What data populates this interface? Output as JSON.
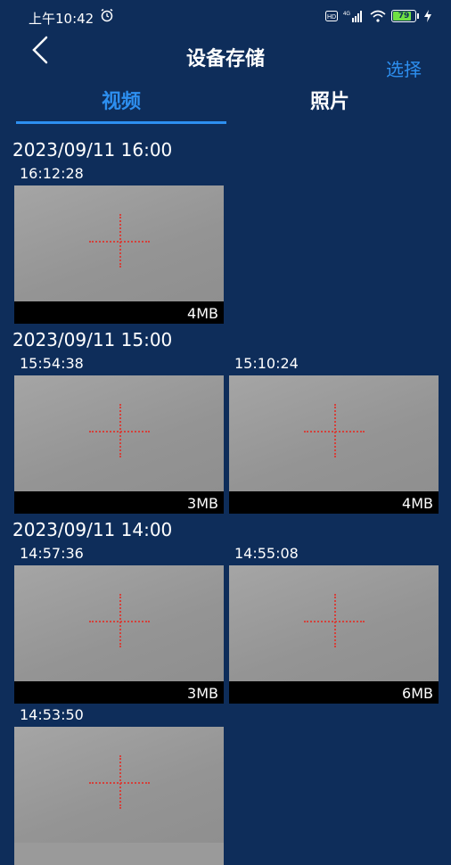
{
  "status": {
    "time": "上午10:42",
    "battery": "79"
  },
  "header": {
    "title": "设备存储",
    "select_label": "选择"
  },
  "tabs": [
    {
      "label": "视频"
    },
    {
      "label": "照片"
    }
  ],
  "groups": [
    {
      "header": "2023/09/11 16:00",
      "items": [
        {
          "time": "16:12:28",
          "size": "4MB"
        }
      ]
    },
    {
      "header": "2023/09/11 15:00",
      "items": [
        {
          "time": "15:54:38",
          "size": "3MB"
        },
        {
          "time": "15:10:24",
          "size": "4MB"
        }
      ]
    },
    {
      "header": "2023/09/11 14:00",
      "items": [
        {
          "time": "14:57:36",
          "size": "3MB"
        },
        {
          "time": "14:55:08",
          "size": "6MB"
        },
        {
          "time": "14:53:50",
          "size": ""
        }
      ]
    }
  ],
  "colors": {
    "background": "#0e2d5a",
    "accent": "#2d8ff0",
    "crosshair": "#d4403a"
  }
}
